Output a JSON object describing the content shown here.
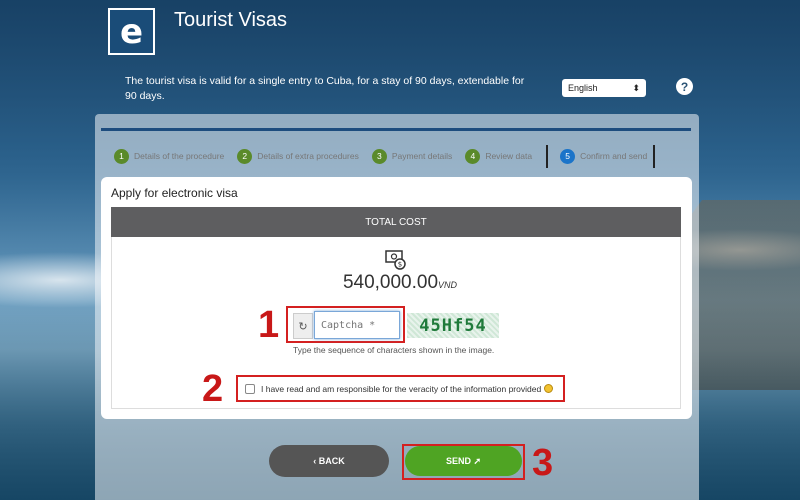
{
  "header": {
    "logo_letter": "e",
    "title": "Tourist Visas",
    "description": "The tourist visa is valid for a single entry to Cuba, for a stay of 90 days, extendable for 90 days."
  },
  "language": {
    "selected": "English",
    "arrow": "⬍"
  },
  "help": {
    "icon": "question-icon",
    "glyph": "?"
  },
  "steps": [
    {
      "num": "1",
      "label": "Details of the procedure"
    },
    {
      "num": "2",
      "label": "Details of extra procedures"
    },
    {
      "num": "3",
      "label": "Payment details"
    },
    {
      "num": "4",
      "label": "Review data"
    },
    {
      "num": "5",
      "label": "Confirm and send"
    }
  ],
  "card": {
    "title": "Apply for electronic visa",
    "cost_header": "TOTAL COST",
    "amount": "540,000.00",
    "currency": "VND"
  },
  "captcha": {
    "refresh_icon": "refresh-icon",
    "refresh_glyph": "↻",
    "placeholder": "Captcha *",
    "image_text": "45Hf54",
    "hint": "Type the sequence of characters shown in the image."
  },
  "agreement": {
    "text": "I have read and am responsible for the veracity of the information provided"
  },
  "markers": [
    "1",
    "2",
    "3"
  ],
  "buttons": {
    "back": "‹   BACK",
    "send": "SEND  ➚"
  },
  "colors": {
    "step_done": "#5a8a2a",
    "step_active": "#1b74c9",
    "highlight": "#d42020",
    "send": "#4fa423"
  }
}
